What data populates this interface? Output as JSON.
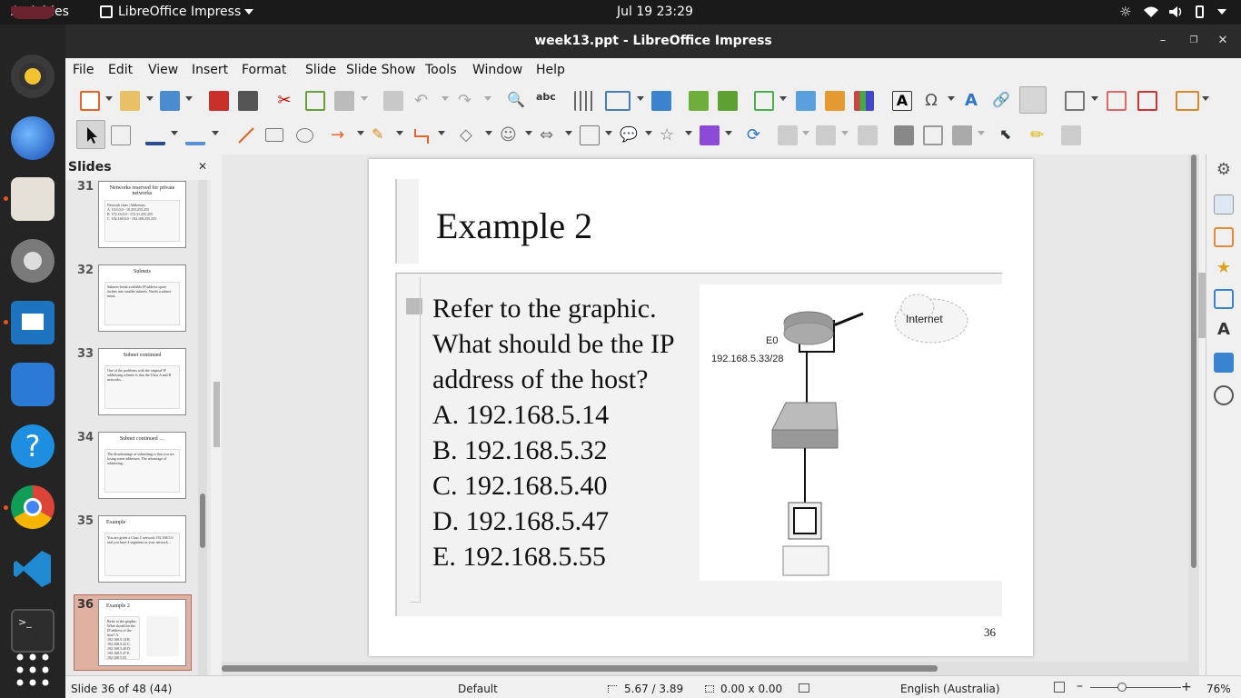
{
  "topbar": {
    "activities": "Activities",
    "app_name": "LibreOffice Impress",
    "clock": "Jul 19  23:29"
  },
  "window": {
    "title": "week13.ppt - LibreOffice Impress"
  },
  "menu": [
    "File",
    "Edit",
    "View",
    "Insert",
    "Format",
    "Slide",
    "Slide Show",
    "Tools",
    "Window",
    "Help"
  ],
  "slides_panel": {
    "title": "Slides",
    "thumbnails": [
      {
        "num": "31",
        "title": "Networks reserved for private networks",
        "body": "Network class | Addresses\nA  10.0.0.0 - 10.255.255.255\nB  172.16.0.0 - 172.31.255.255\nC  192.168.0.0 - 192.168.255.255"
      },
      {
        "num": "32",
        "title": "Subnets",
        "body": "Subnets break available IP address space further into smaller subnets. Needs a subnet mask."
      },
      {
        "num": "33",
        "title": "Subnet continued",
        "body": "One of the problems with the original IP addressing scheme is that the Class A and B networks..."
      },
      {
        "num": "34",
        "title": "Subnet continued …",
        "body": "The disadvantage of subnetting is that you are losing some addresses. The advantage of subnetting..."
      },
      {
        "num": "35",
        "title": "Example",
        "body": "You are given a Class C network 192.168.5.0 and you have 4 segments in your network..."
      },
      {
        "num": "36",
        "title": "Example 2",
        "body": "Refer to the graphic. What should be the IP address of the host? A. 192.168.5.14 B. 192.168.5.32 C. 192.168.5.40 D. 192.168.5.47 E. 192.168.5.55"
      }
    ]
  },
  "slide": {
    "title": "Example 2",
    "question_lines": [
      "Refer to the graphic.",
      "What should be the IP",
      "address of the host?"
    ],
    "options": [
      "A. 192.168.5.14",
      "B. 192.168.5.32",
      "C. 192.168.5.40",
      "D. 192.168.5.47",
      "E. 192.168.5.55"
    ],
    "page_number": "36",
    "diagram": {
      "interface": "E0",
      "address": "192.168.5.33/28",
      "cloud_label": "Internet"
    }
  },
  "status": {
    "slide_info": "Slide 36 of 48 (44)",
    "layout": "Default",
    "position": "5.67 / 3.89",
    "size": "0.00 x 0.00",
    "language": "English (Australia)",
    "zoom": "76%"
  },
  "colors": {
    "accent": "#e95420",
    "dock": "#242424",
    "selected_thumb": "#e0b0a0"
  }
}
